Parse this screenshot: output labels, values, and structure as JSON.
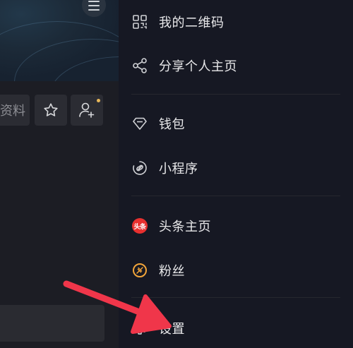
{
  "profile": {
    "edit_label": "资料",
    "colors": {
      "banner": "#1c2a38",
      "button": "#2b2c33",
      "notify_dot": "#e8b85a"
    }
  },
  "drawer": {
    "items": [
      {
        "label": "我的二维码",
        "icon": "qr-code-icon"
      },
      {
        "label": "分享个人主页",
        "icon": "share-icon"
      },
      {
        "label": "钱包",
        "icon": "diamond-wallet-icon"
      },
      {
        "label": "小程序",
        "icon": "link-mini-program-icon"
      },
      {
        "label": "头条主页",
        "icon": "toutiao-logo-icon",
        "badge_text": "头条"
      },
      {
        "label": "粉丝",
        "icon": "fans-icon"
      },
      {
        "label": "设置",
        "icon": "gear-icon"
      }
    ],
    "colors": {
      "background": "#161823",
      "text": "#e8e8ea",
      "toutiao": "#e8302f",
      "fans": "#f2a53a"
    }
  },
  "annotation": {
    "arrow_color": "#f0364a",
    "points_to": "设置"
  }
}
